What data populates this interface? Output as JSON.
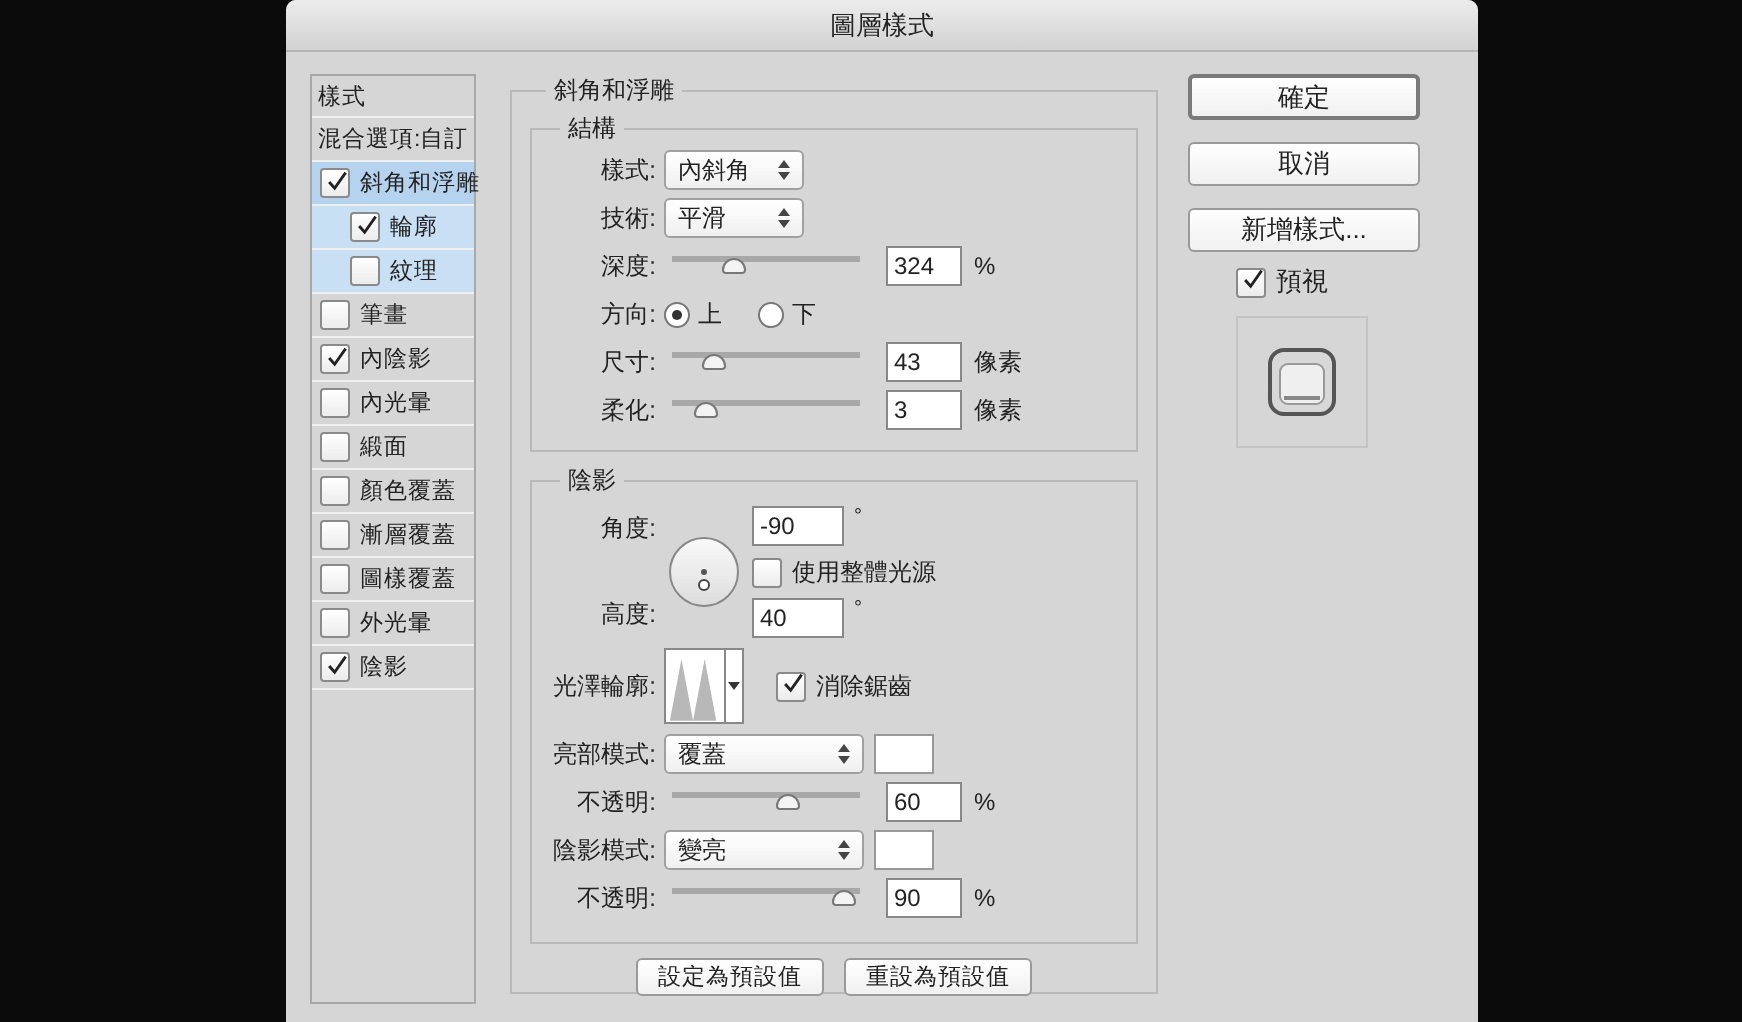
{
  "window": {
    "title": "圖層樣式"
  },
  "styles_panel": {
    "header": "樣式",
    "blending_options": "混合選項:自訂",
    "items": [
      {
        "label": "斜角和浮雕",
        "checked": true,
        "selected": true,
        "children": [
          {
            "label": "輪廓",
            "checked": true,
            "selected": false
          },
          {
            "label": "紋理",
            "checked": false,
            "selected": false
          }
        ]
      },
      {
        "label": "筆畫",
        "checked": false,
        "selected": false
      },
      {
        "label": "內陰影",
        "checked": true,
        "selected": false
      },
      {
        "label": "內光暈",
        "checked": false,
        "selected": false
      },
      {
        "label": "緞面",
        "checked": false,
        "selected": false
      },
      {
        "label": "顏色覆蓋",
        "checked": false,
        "selected": false
      },
      {
        "label": "漸層覆蓋",
        "checked": false,
        "selected": false
      },
      {
        "label": "圖樣覆蓋",
        "checked": false,
        "selected": false
      },
      {
        "label": "外光暈",
        "checked": false,
        "selected": false
      },
      {
        "label": "陰影",
        "checked": true,
        "selected": false
      }
    ]
  },
  "bevel_emboss": {
    "title": "斜角和浮雕",
    "structure": {
      "title": "結構",
      "style": {
        "label": "樣式:",
        "value": "內斜角"
      },
      "technique": {
        "label": "技術:",
        "value": "平滑"
      },
      "depth": {
        "label": "深度:",
        "level": 0.33,
        "value": "324",
        "unit": "%"
      },
      "direction": {
        "label": "方向:",
        "options": [
          {
            "label": "上",
            "selected": true
          },
          {
            "label": "下",
            "selected": false
          }
        ]
      },
      "size": {
        "label": "尺寸:",
        "level": 0.22,
        "value": "43",
        "unit": "像素"
      },
      "soften": {
        "label": "柔化:",
        "level": 0.18,
        "value": "3",
        "unit": "像素"
      }
    },
    "shading": {
      "title": "陰影",
      "angle": {
        "label": "角度:",
        "value": "-90",
        "unit": "°"
      },
      "global_light": {
        "label": "使用整體光源",
        "checked": false
      },
      "altitude": {
        "label": "高度:",
        "value": "40",
        "unit": "°"
      },
      "gloss_contour": {
        "label": "光澤輪廓:"
      },
      "anti_aliased": {
        "label": "消除鋸齒",
        "checked": true
      },
      "highlight_mode": {
        "label": "亮部模式:",
        "value": "覆蓋",
        "color": "#ffffff"
      },
      "highlight_opacity": {
        "label": "不透明:",
        "level": 0.62,
        "value": "60",
        "unit": "%"
      },
      "shadow_mode": {
        "label": "陰影模式:",
        "value": "變亮",
        "color": "#ffffff"
      },
      "shadow_opacity": {
        "label": "不透明:",
        "level": 0.92,
        "value": "90",
        "unit": "%"
      }
    },
    "buttons": [
      "設定為預設值",
      "重設為預設值"
    ]
  },
  "side_buttons": [
    "確定",
    "取消",
    "新增樣式..."
  ],
  "preview": {
    "label": "預視",
    "checked": true
  }
}
